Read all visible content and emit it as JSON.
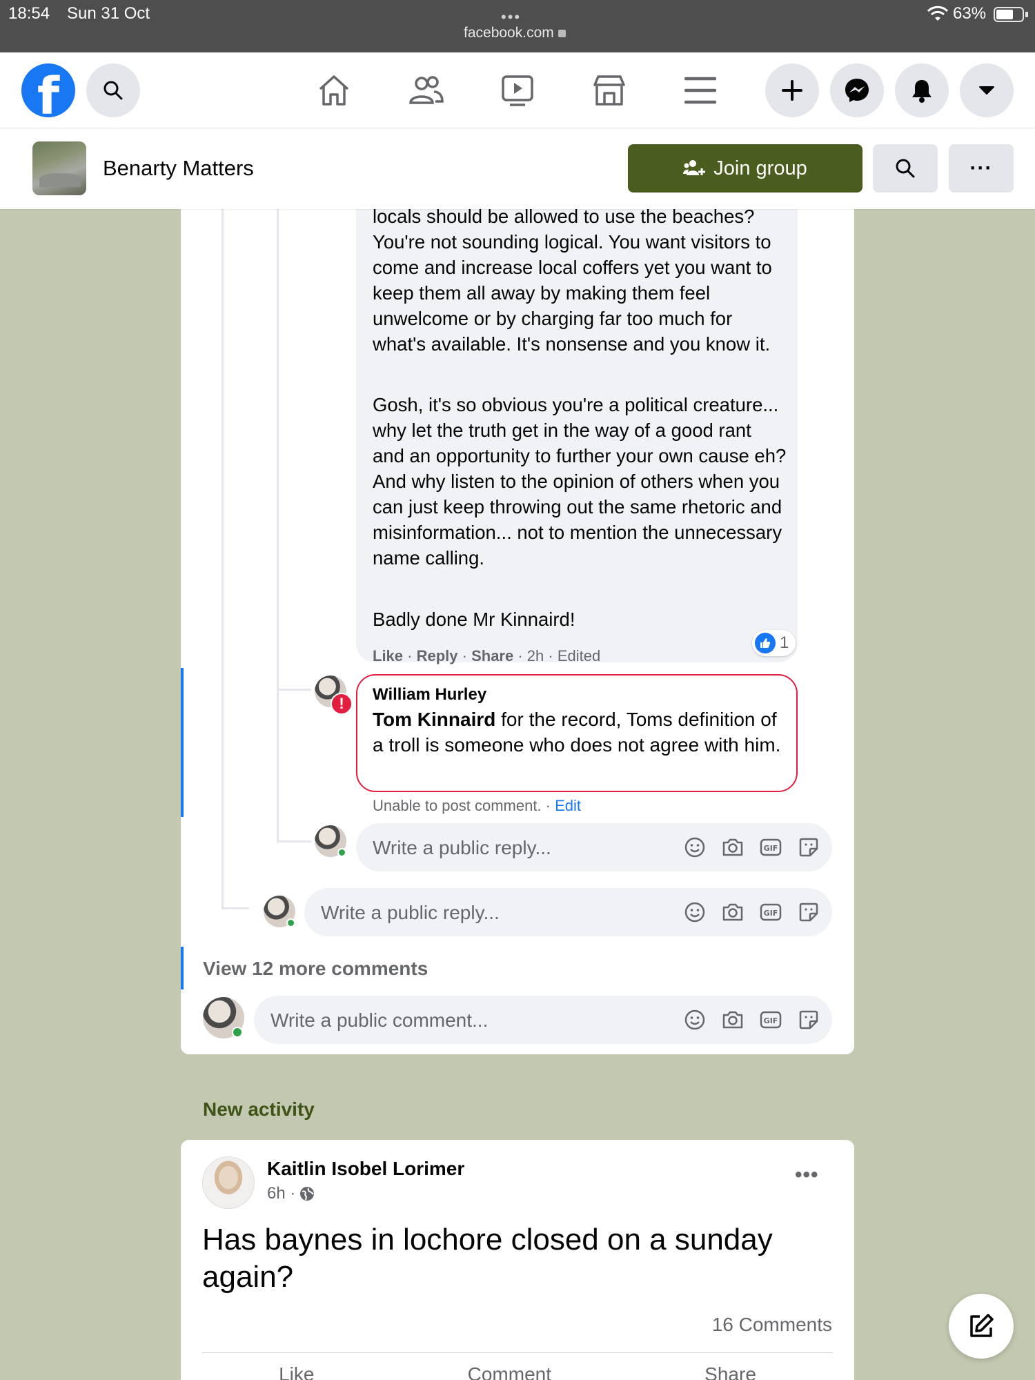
{
  "status_bar": {
    "time": "18:54",
    "date": "Sun 31 Oct",
    "url": "facebook.com",
    "battery": "63%"
  },
  "topnav": {
    "logo": "f"
  },
  "group": {
    "name": "Benarty Matters",
    "join_label": "Join group",
    "more_label": "···"
  },
  "thread": {
    "comment_paragraphs": [
      "locals should be allowed to use the beaches? You're not sounding logical. You want visitors to come and increase local coffers yet you want to keep them all away by making them feel unwelcome or by charging far too much for what's available. It's nonsense and you know it.",
      "Gosh, it's so obvious you're a political creature... why let the truth get in the way of a good rant and an opportunity to further your own cause eh? And why listen to the opinion of others when you can just keep throwing out the same rhetoric and misinformation... not to mention the unnecessary name calling.",
      "Badly done Mr Kinnaird!"
    ],
    "reaction_count": "1",
    "meta": {
      "like": "Like",
      "reply": "Reply",
      "share": "Share",
      "time": "2h",
      "edited": "Edited"
    },
    "failed_reply": {
      "author": "William Hurley",
      "mention": "Tom Kinnaird",
      "text": " for the record, Toms definition of a troll is someone who does not agree with him.",
      "error_text": "Unable to post comment. · ",
      "edit_label": "Edit"
    },
    "reply_placeholder": "Write a public reply...",
    "view_more": "View 12 more comments",
    "comment_placeholder": "Write a public comment..."
  },
  "new_activity": {
    "heading": "New activity",
    "author": "Kaitlin Isobel Lorimer",
    "time": "6h ·",
    "post_text": "Has baynes in lochore closed on a sunday again?",
    "comments": "16 Comments",
    "actions": [
      "Like",
      "Comment",
      "Share"
    ]
  },
  "colors": {
    "fb_blue": "#1877f2",
    "join_green": "#4b5d1e",
    "error_red": "#e41e3f",
    "page_bg": "#c3c9b0"
  }
}
